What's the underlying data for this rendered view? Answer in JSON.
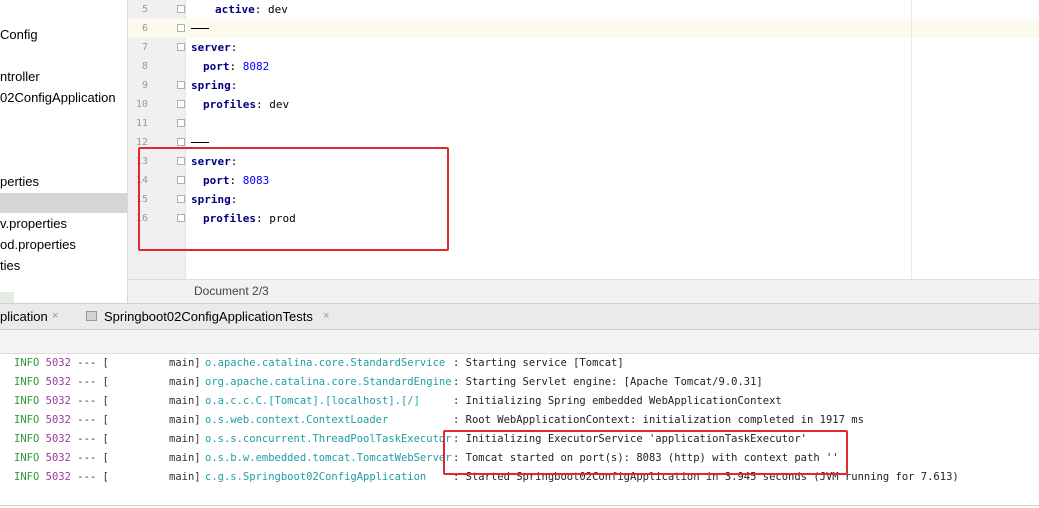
{
  "tree": {
    "items": [
      {
        "label": "Config"
      },
      {
        "label": "ntroller"
      },
      {
        "label": "02ConfigApplication"
      },
      {
        "label": "perties"
      },
      {
        "label": ""
      },
      {
        "label": "v.properties"
      },
      {
        "label": "od.properties"
      },
      {
        "label": "ties"
      }
    ]
  },
  "editor": {
    "line_numbers": [
      "5",
      "6",
      "7",
      "8",
      "9",
      "10",
      "11",
      "12",
      "13",
      "14",
      "15",
      "16"
    ],
    "lines": [
      {
        "key": "active",
        "value": "dev"
      },
      {
        "key": "server"
      },
      {
        "key": "port",
        "value": "8082"
      },
      {
        "key": "spring"
      },
      {
        "key": "profiles",
        "value": "dev"
      },
      {
        "key": "server"
      },
      {
        "key": "port",
        "value": "8083"
      },
      {
        "key": "spring"
      },
      {
        "key": "profiles",
        "value": "prod"
      }
    ],
    "status": "Document 2/3"
  },
  "run": {
    "tabs": [
      {
        "label": "plication"
      },
      {
        "label": "Springboot02ConfigApplicationTests"
      }
    ],
    "close_glyph": "×"
  },
  "console": {
    "lines": [
      {
        "level": "INFO",
        "pid": "5032",
        "dash": "---",
        "bracket": "[",
        "thread": "main]",
        "logger": "o.apache.catalina.core.StandardService",
        "message": ": Starting service [Tomcat]"
      },
      {
        "level": "INFO",
        "pid": "5032",
        "dash": "---",
        "bracket": "[",
        "thread": "main]",
        "logger": "org.apache.catalina.core.StandardEngine",
        "message": ": Starting Servlet engine: [Apache Tomcat/9.0.31]"
      },
      {
        "level": "INFO",
        "pid": "5032",
        "dash": "---",
        "bracket": "[",
        "thread": "main]",
        "logger": "o.a.c.c.C.[Tomcat].[localhost].[/]",
        "message": ": Initializing Spring embedded WebApplicationContext"
      },
      {
        "level": "INFO",
        "pid": "5032",
        "dash": "---",
        "bracket": "[",
        "thread": "main]",
        "logger": "o.s.web.context.ContextLoader",
        "message": ": Root WebApplicationContext: initialization completed in 1917 ms"
      },
      {
        "level": "INFO",
        "pid": "5032",
        "dash": "---",
        "bracket": "[",
        "thread": "main]",
        "logger": "o.s.s.concurrent.ThreadPoolTaskExecutor",
        "message": ": Initializing ExecutorService 'applicationTaskExecutor'"
      },
      {
        "level": "INFO",
        "pid": "5032",
        "dash": "---",
        "bracket": "[",
        "thread": "main]",
        "logger": "o.s.b.w.embedded.tomcat.TomcatWebServer",
        "message": ": Tomcat started on port(s): 8083 (http) with context path ''"
      },
      {
        "level": "INFO",
        "pid": "5032",
        "dash": "---",
        "bracket": "[",
        "thread": "main]",
        "logger": "c.g.s.Springboot02ConfigApplication",
        "message": ": Started Springboot02ConfigApplication in 3.945 seconds (JVM running for 7.613)"
      }
    ]
  },
  "colors": {
    "annotation": "#e0282d",
    "yaml_key": "#000080",
    "yaml_number": "#0000ff",
    "log_level": "#2f9a35",
    "log_pid": "#9b3a9b",
    "log_logger": "#1f9ea6"
  }
}
